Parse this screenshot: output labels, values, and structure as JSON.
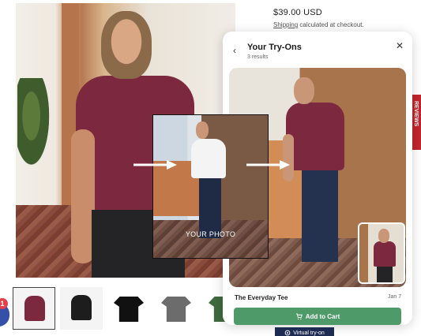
{
  "product": {
    "price": "$39.00 USD",
    "shipping_link": "Shipping",
    "shipping_rest": " calculated at checkout."
  },
  "side_tab": {
    "label": "REVIEWS"
  },
  "badge": {
    "count": "1"
  },
  "tryon_panel": {
    "title": "Your Try-Ons",
    "results": "3 results",
    "item_name": "The Everyday Tee",
    "item_date": "Jan 7",
    "add_to_cart": "Add to Cart"
  },
  "your_photo": {
    "label": "YOUR PHOTO"
  },
  "virtual_tryon": {
    "label": "Virtual try-on"
  },
  "thumbnails": [
    {
      "name": "thumbnail-maroon-tee-model",
      "color": "#7c2940"
    },
    {
      "name": "thumbnail-black-tee-model",
      "color": "#1d1d1d"
    },
    {
      "name": "thumbnail-black-tee-flat",
      "color": "#111111"
    },
    {
      "name": "thumbnail-gray-tee-flat",
      "color": "#6c6c6c"
    },
    {
      "name": "thumbnail-green-tee-flat",
      "color": "#3f6a3f"
    }
  ],
  "colors": {
    "cart_button": "#4e9a68",
    "vto_button": "#1d2b52",
    "review_tab": "#c0272d",
    "badge": "#e0414b",
    "tee_maroon": "#7c2940"
  },
  "icons": {
    "back": "chevron-left-icon",
    "close": "close-icon",
    "cart": "cart-icon",
    "camera": "camera-icon"
  }
}
